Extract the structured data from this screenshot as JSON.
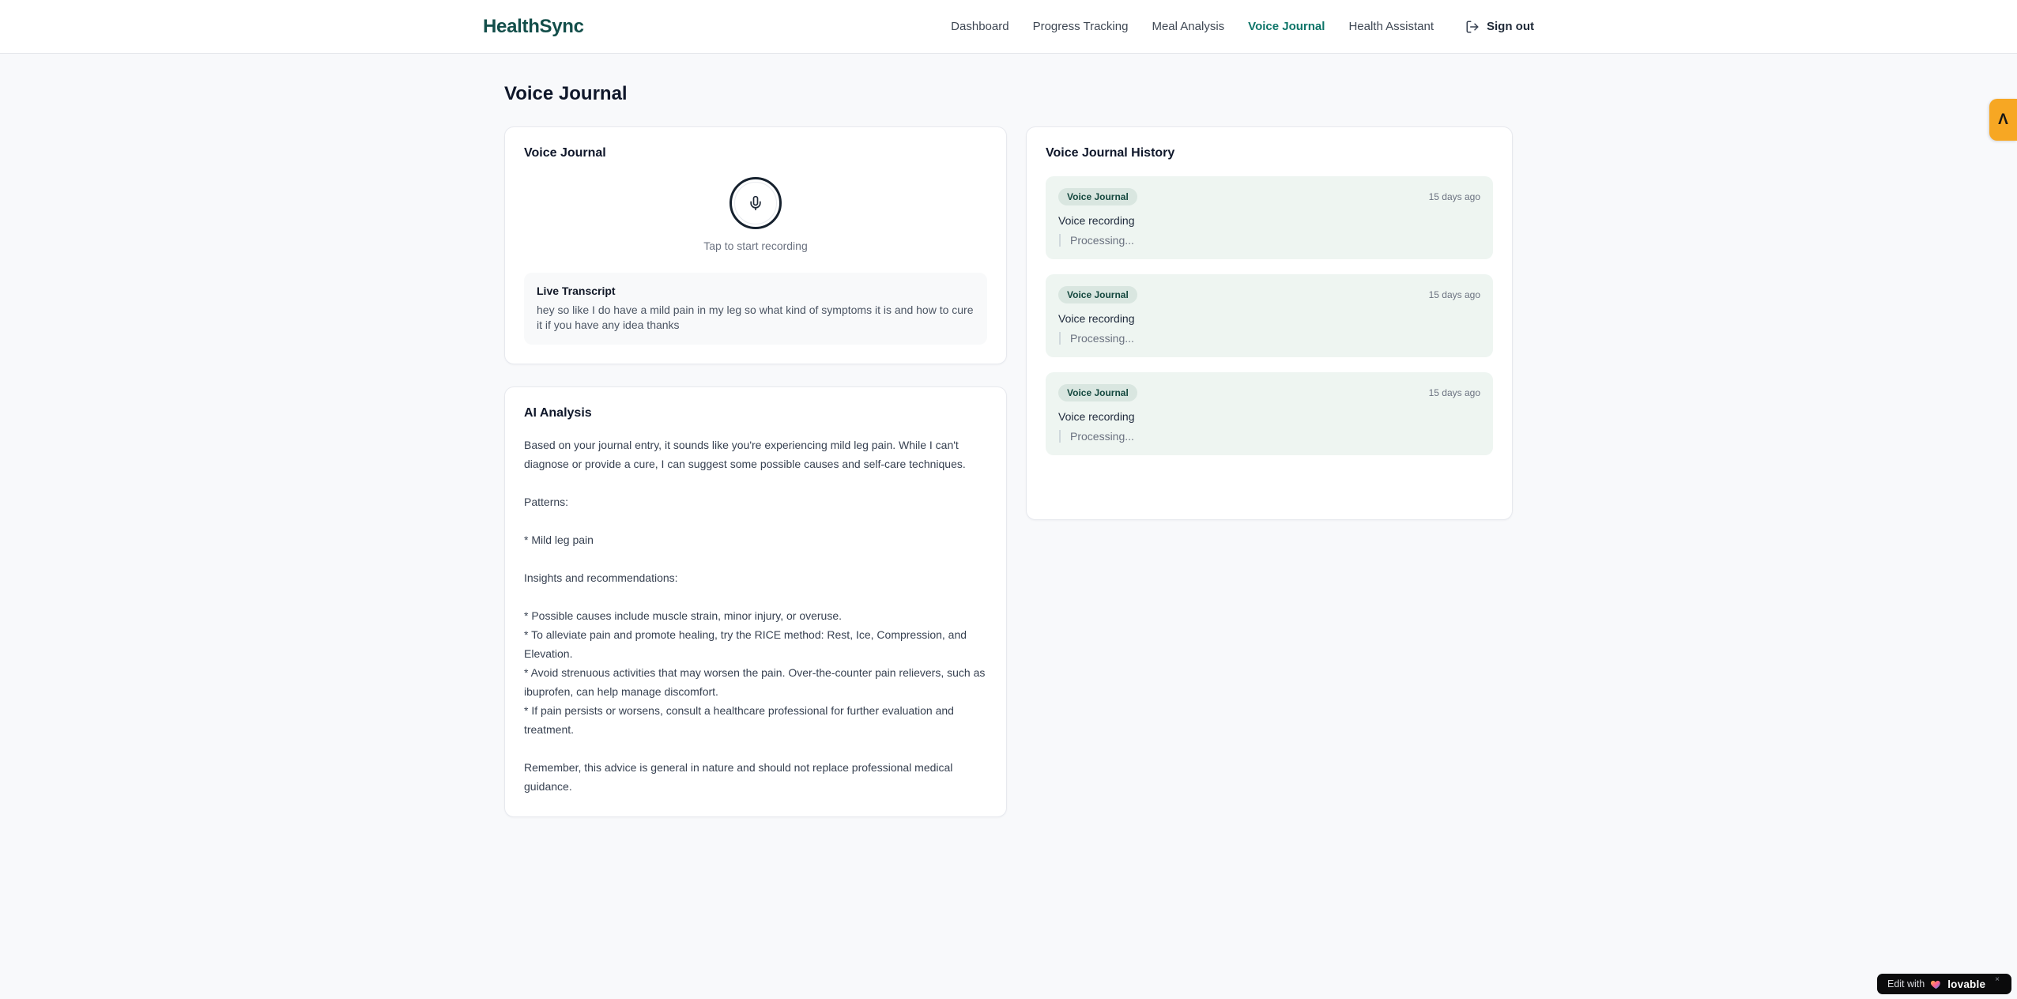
{
  "header": {
    "brand": "HealthSync",
    "nav": [
      {
        "label": "Dashboard",
        "active": false
      },
      {
        "label": "Progress Tracking",
        "active": false
      },
      {
        "label": "Meal Analysis",
        "active": false
      },
      {
        "label": "Voice Journal",
        "active": true
      },
      {
        "label": "Health Assistant",
        "active": false
      }
    ],
    "sign_out_label": "Sign out"
  },
  "page_title": "Voice Journal",
  "recorder": {
    "title": "Voice Journal",
    "tap_hint": "Tap to start recording",
    "transcript": {
      "title": "Live Transcript",
      "text": "hey so like I do have a mild pain in my leg so what kind of symptoms it is and how to cure it if you have any idea thanks"
    }
  },
  "analysis": {
    "title": "AI Analysis",
    "paragraphs": [
      "Based on your journal entry, it sounds like you're experiencing mild leg pain. While I can't diagnose or provide a cure, I can suggest some possible causes and self-care techniques.",
      "Patterns:",
      "* Mild leg pain",
      "Insights and recommendations:",
      "* Possible causes include muscle strain, minor injury, or overuse.\n* To alleviate pain and promote healing, try the RICE method: Rest, Ice, Compression, and Elevation.\n* Avoid strenuous activities that may worsen the pain. Over-the-counter pain relievers, such as ibuprofen, can help manage discomfort.\n* If pain persists or worsens, consult a healthcare professional for further evaluation and treatment.",
      "Remember, this advice is general in nature and should not replace professional medical guidance."
    ]
  },
  "history": {
    "title": "Voice Journal History",
    "entries": [
      {
        "badge": "Voice Journal",
        "time": "15 days ago",
        "label": "Voice recording",
        "status": "Processing..."
      },
      {
        "badge": "Voice Journal",
        "time": "15 days ago",
        "label": "Voice recording",
        "status": "Processing..."
      },
      {
        "badge": "Voice Journal",
        "time": "15 days ago",
        "label": "Voice recording",
        "status": "Processing..."
      }
    ]
  },
  "overlays": {
    "side_badge_glyph": "Λ",
    "edit_badge": {
      "prefix": "Edit with",
      "brand": "lovable",
      "close": "×"
    }
  },
  "colors": {
    "brand_teal": "#134e4a",
    "nav_active_teal": "#0e7569",
    "entry_bg": "#eef5f1",
    "badge_bg": "#d9e6e0",
    "badge_text": "#15493f",
    "side_badge_bg": "#f7a723",
    "edit_badge_bg": "#0b0b0c",
    "page_bg": "#f8f9fb"
  }
}
